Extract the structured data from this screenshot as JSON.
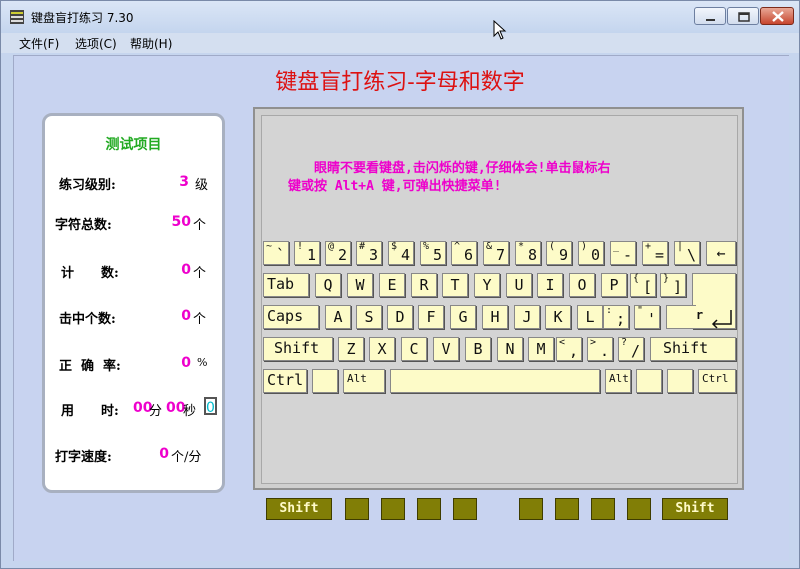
{
  "window": {
    "title": "键盘盲打练习 7.30"
  },
  "menu": [
    "文件(F)",
    "选项(C)",
    "帮助(H)"
  ],
  "main_title": "键盘盲打练习-字母和数字",
  "stats": {
    "title": "测试项目",
    "level_label": "练习级别:",
    "level_value": "3",
    "level_unit": "级",
    "chars_label": "字符总数:",
    "chars_value": "50",
    "chars_unit": "个",
    "count_label_a": "计",
    "count_label_b": "数:",
    "count_value": "0",
    "count_unit": "个",
    "hits_label": "击中个数:",
    "hits_value": "0",
    "hits_unit": "个",
    "acc_label_a": "正",
    "acc_label_b": "确",
    "acc_label_c": "率:",
    "acc_value": "0",
    "acc_unit": "%",
    "time_label_a": "用",
    "time_label_b": "时:",
    "time_min": "00",
    "time_min_unit": "分",
    "time_sec": "00",
    "time_sec_unit": "秒",
    "time_box": "0",
    "speed_label": "打字速度:",
    "speed_value": "0",
    "speed_unit": "个/分"
  },
  "instruction": {
    "line1": "眼睛不要看键盘,击闪烁的键,仔细体会!单击鼠标右",
    "line2": "键或按 Alt+A 键,可弹出快捷菜单!"
  },
  "keyboard": {
    "row1": [
      [
        "~",
        "`"
      ],
      [
        "!",
        "1"
      ],
      [
        "@",
        "2"
      ],
      [
        "#",
        "3"
      ],
      [
        "$",
        "4"
      ],
      [
        "%",
        "5"
      ],
      [
        "^",
        "6"
      ],
      [
        "&",
        "7"
      ],
      [
        "*",
        "8"
      ],
      [
        "(",
        "9"
      ],
      [
        ")",
        "0"
      ],
      [
        "_",
        "-"
      ],
      [
        "+",
        "="
      ],
      [
        "|",
        "\\"
      ]
    ],
    "backspace": "←",
    "tab": "Tab",
    "row2": [
      "Q",
      "W",
      "E",
      "R",
      "T",
      "Y",
      "U",
      "I",
      "O",
      "P"
    ],
    "row2_sym": [
      [
        "{",
        "["
      ],
      [
        "}",
        "]"
      ]
    ],
    "caps": "Caps",
    "row3": [
      "A",
      "S",
      "D",
      "F",
      "G",
      "H",
      "J",
      "K",
      "L"
    ],
    "row3_sym": [
      [
        ":",
        ";"
      ],
      [
        "\"",
        "'"
      ]
    ],
    "enter": "Enter",
    "shift_left": "Shift",
    "row4": [
      "Z",
      "X",
      "C",
      "V",
      "B",
      "N",
      "M"
    ],
    "row4_sym": [
      [
        "<",
        ","
      ],
      [
        ">",
        "."
      ],
      [
        "?",
        "/"
      ]
    ],
    "shift_right": "Shift",
    "ctrl_left": "Ctrl",
    "alt_left": "Alt",
    "alt_right": "Alt",
    "ctrl_right": "Ctrl"
  },
  "fingers": {
    "shift_left": "Shift",
    "shift_right": "Shift"
  }
}
